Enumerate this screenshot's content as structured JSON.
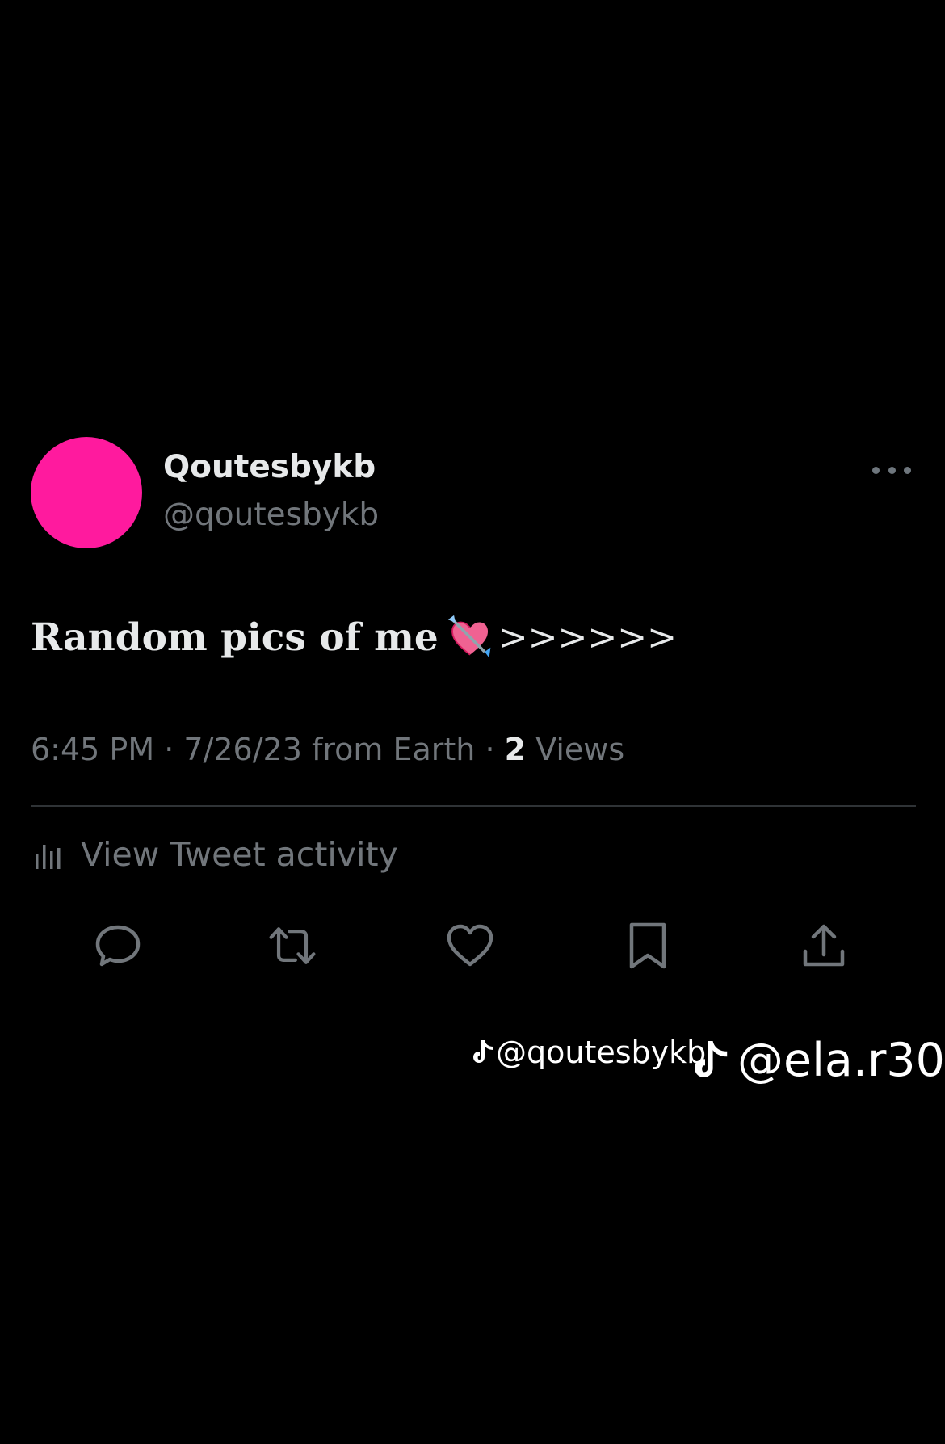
{
  "colors": {
    "background": "#000000",
    "avatar": "#ff1a9e",
    "primary_text": "#e7e9ea",
    "secondary_text": "#71767b",
    "divider": "#2f3336"
  },
  "author": {
    "display_name": "Qoutesbykb",
    "handle": "@qoutesbykb"
  },
  "tweet": {
    "text": "Random pics of me",
    "emoji": "heart-with-arrow-icon",
    "arrows": ">>>>>>"
  },
  "meta": {
    "time": "6:45 PM",
    "date": "7/26/23",
    "source": "from Earth",
    "separator": " · ",
    "views_count": "2",
    "views_label": "Views"
  },
  "activity": {
    "label": "View Tweet activity",
    "icon": "bar-chart-icon"
  },
  "actions": [
    {
      "name": "reply",
      "icon": "reply-icon"
    },
    {
      "name": "retweet",
      "icon": "retweet-icon"
    },
    {
      "name": "like",
      "icon": "heart-icon"
    },
    {
      "name": "bookmark",
      "icon": "bookmark-icon"
    },
    {
      "name": "share",
      "icon": "share-icon"
    }
  ],
  "watermarks": {
    "small": "@qoutesbykb",
    "big": "@ela.r30"
  }
}
